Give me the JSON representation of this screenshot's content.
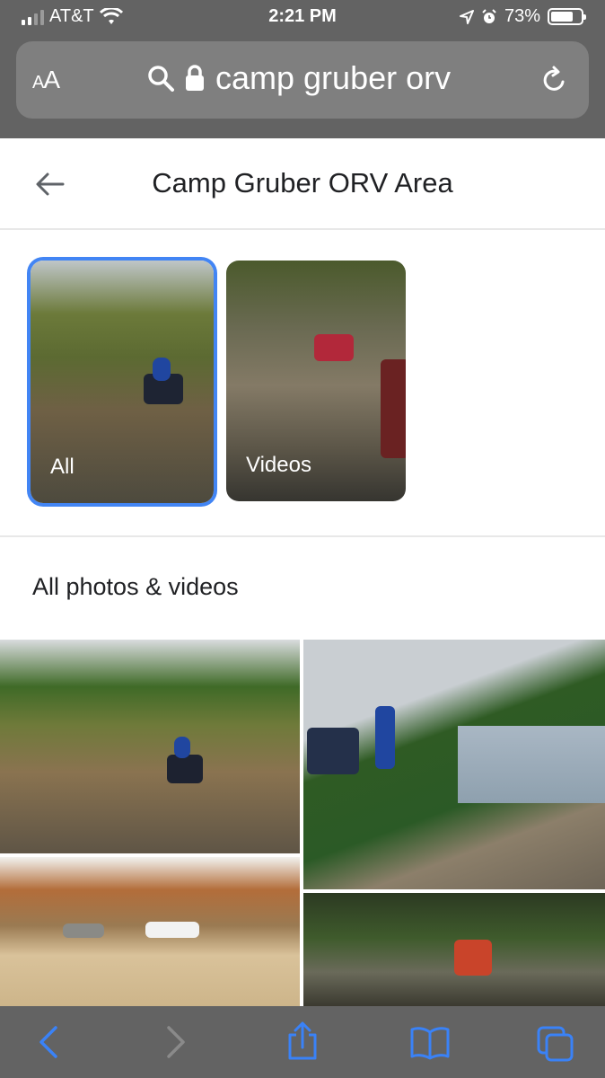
{
  "status": {
    "carrier": "AT&T",
    "time": "2:21 PM",
    "battery": "73%",
    "battery_level": 0.73,
    "icons": [
      "signal-icon",
      "wifi-icon",
      "location-icon",
      "alarm-icon",
      "battery-icon"
    ]
  },
  "urlbar": {
    "aa_label_big": "A",
    "aa_label_small": "A",
    "query": "camp gruber orv",
    "icons": [
      "search-icon",
      "lock-icon",
      "reload-icon"
    ]
  },
  "header": {
    "title": "Camp Gruber ORV Area",
    "back_icon": "back-arrow-icon"
  },
  "filters": [
    {
      "label": "All",
      "selected": true
    },
    {
      "label": "Videos",
      "selected": false
    }
  ],
  "section": {
    "title": "All photos & videos"
  },
  "gallery": [
    {
      "name": "atv-hill-photo"
    },
    {
      "name": "cliff-overlook-photo"
    },
    {
      "name": "dirt-lot-photo"
    },
    {
      "name": "forest-atv-photo"
    }
  ],
  "toolbar": {
    "icons": [
      "back-icon",
      "forward-icon",
      "share-icon",
      "bookmarks-icon",
      "tabs-icon"
    ]
  },
  "colors": {
    "accent": "#4285f4",
    "chrome": "#636363",
    "tool_blue": "#3a82f7"
  }
}
